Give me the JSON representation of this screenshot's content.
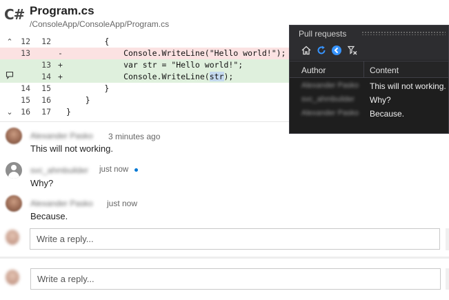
{
  "file": {
    "language_icon": "C#",
    "name": "Program.cs",
    "path": "/ConsoleApp/ConsoleApp/Program.cs"
  },
  "diff": {
    "lines": [
      {
        "type": "context",
        "old": "12",
        "new": "12",
        "marker": "",
        "code": "        {",
        "icon": "chevron-up-icon",
        "icon_glyph": "⌃"
      },
      {
        "type": "removed",
        "old": "13",
        "new": "",
        "marker": "-",
        "code": "            Console.WriteLine(\"Hello world!\");",
        "icon": "",
        "icon_glyph": ""
      },
      {
        "type": "added",
        "old": "",
        "new": "13",
        "marker": "+",
        "code": "            var str = \"Hello world!\";",
        "icon": "",
        "icon_glyph": ""
      },
      {
        "type": "added",
        "old": "",
        "new": "14",
        "marker": "+",
        "code_prefix": "            Console.WriteLine(",
        "code_highlight": "str",
        "code_suffix": ");",
        "icon": "comment-icon",
        "icon_glyph": "▭"
      },
      {
        "type": "context",
        "old": "14",
        "new": "15",
        "marker": "",
        "code": "        }",
        "icon": "",
        "icon_glyph": ""
      },
      {
        "type": "context",
        "old": "15",
        "new": "16",
        "marker": "",
        "code": "    }",
        "icon": "",
        "icon_glyph": ""
      },
      {
        "type": "context",
        "old": "16",
        "new": "17",
        "marker": "",
        "code": "}",
        "icon": "chevron-down-icon",
        "icon_glyph": "⌄"
      }
    ]
  },
  "comments": [
    {
      "author": "Alexander Pasko",
      "time": "3 minutes ago",
      "text": "This will not working.",
      "avatar": "photo"
    },
    {
      "author": "svc_ahmbuilder",
      "time": "just now",
      "text": "Why?",
      "avatar": "generic",
      "unread": true
    },
    {
      "author": "Alexander Pasko",
      "time": "just now",
      "text": "Because.",
      "avatar": "photo"
    }
  ],
  "reply": {
    "placeholder": "Write a reply..."
  },
  "pull_requests": {
    "title": "Pull requests",
    "toolbar": [
      "home-icon",
      "refresh-icon",
      "back-icon",
      "filter-icon"
    ],
    "columns": {
      "author": "Author",
      "content": "Content"
    },
    "rows": [
      {
        "author": "Alexander Pasko",
        "content": "This will not working."
      },
      {
        "author": "svc_ahmbuilder",
        "content": "Why?"
      },
      {
        "author": "Alexander Pasko",
        "content": "Because."
      }
    ]
  },
  "colors": {
    "removed_bg": "#fbe2e2",
    "added_bg": "#dff0dd",
    "unread_dot": "#0078d4",
    "panel_bg": "#1e1e1e",
    "icon_blue": "#3794ff"
  }
}
